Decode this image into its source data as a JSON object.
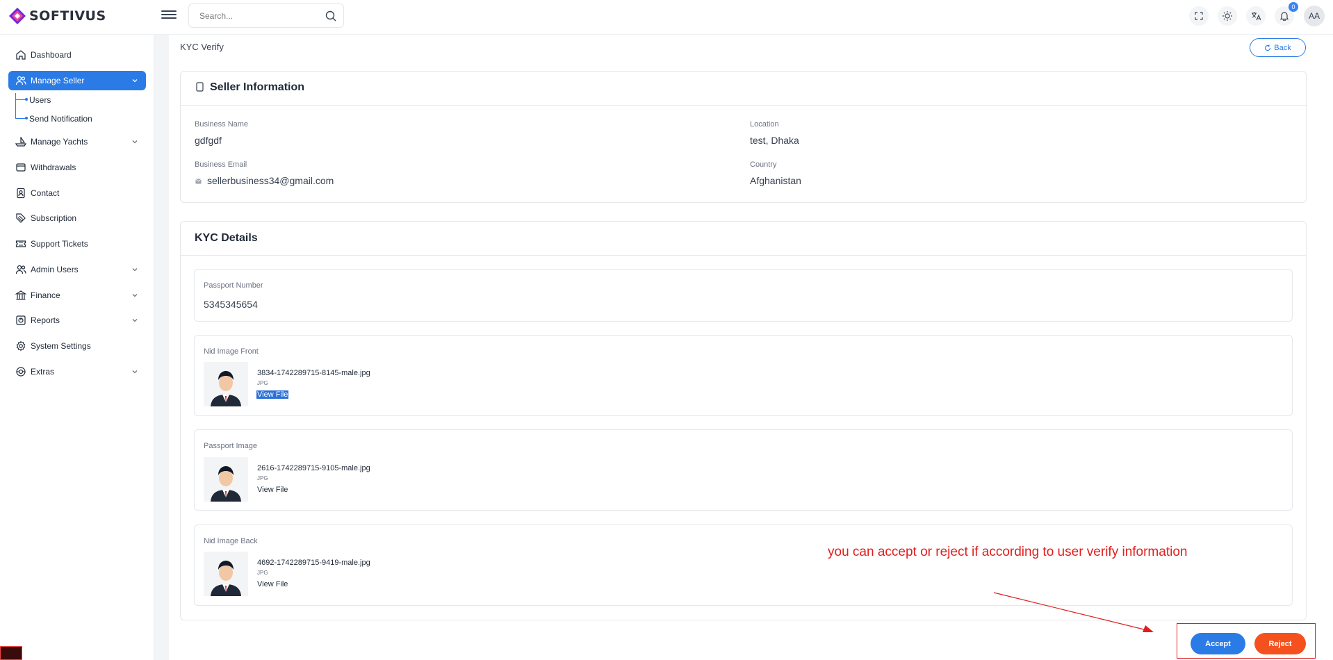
{
  "brand": {
    "name": "SOFTIVUS"
  },
  "search": {
    "placeholder": "Search..."
  },
  "topbar": {
    "notification_count": "0",
    "avatar_initials": "AA"
  },
  "sidebar": {
    "items": [
      {
        "label": "Dashboard",
        "icon": "home-icon"
      },
      {
        "label": "Manage Seller",
        "icon": "users-icon",
        "active": true,
        "expandable": true
      },
      {
        "label": "Manage Yachts",
        "icon": "ship-icon",
        "expandable": true
      },
      {
        "label": "Withdrawals",
        "icon": "wallet-icon"
      },
      {
        "label": "Contact",
        "icon": "contact-icon"
      },
      {
        "label": "Subscription",
        "icon": "tag-icon"
      },
      {
        "label": "Support Tickets",
        "icon": "ticket-icon"
      },
      {
        "label": "Admin Users",
        "icon": "users-icon",
        "expandable": true
      },
      {
        "label": "Finance",
        "icon": "bank-icon",
        "expandable": true
      },
      {
        "label": "Reports",
        "icon": "report-icon",
        "expandable": true
      },
      {
        "label": "System Settings",
        "icon": "gear-icon"
      },
      {
        "label": "Extras",
        "icon": "globe-icon",
        "expandable": true
      }
    ],
    "sub_items": [
      "Users",
      "Send Notification"
    ]
  },
  "page": {
    "title": "KYC Verify",
    "back_label": "Back"
  },
  "seller_info": {
    "title": "Seller Information",
    "business_name_label": "Business Name",
    "business_name": "gdfgdf",
    "location_label": "Location",
    "location": "test, Dhaka",
    "business_email_label": "Business Email",
    "business_email": "sellerbusiness34@gmail.com",
    "country_label": "Country",
    "country": "Afghanistan"
  },
  "kyc": {
    "title": "KYC Details",
    "passport_number_label": "Passport Number",
    "passport_number": "5345345654",
    "files": [
      {
        "label": "Nid Image Front",
        "filename": "3834-1742289715-8145-male.jpg",
        "type": "JPG",
        "link": "View File"
      },
      {
        "label": "Passport Image",
        "filename": "2616-1742289715-9105-male.jpg",
        "type": "JPG",
        "link": "View File"
      },
      {
        "label": "Nid Image Back",
        "filename": "4692-1742289715-9419-male.jpg",
        "type": "JPG",
        "link": "View File"
      }
    ]
  },
  "annotation": "you can accept or reject if according to user verify information",
  "actions": {
    "accept": "Accept",
    "reject": "Reject"
  },
  "colors": {
    "primary": "#2b7be6",
    "reject": "#f4511e",
    "annotation": "#e11d1d"
  }
}
